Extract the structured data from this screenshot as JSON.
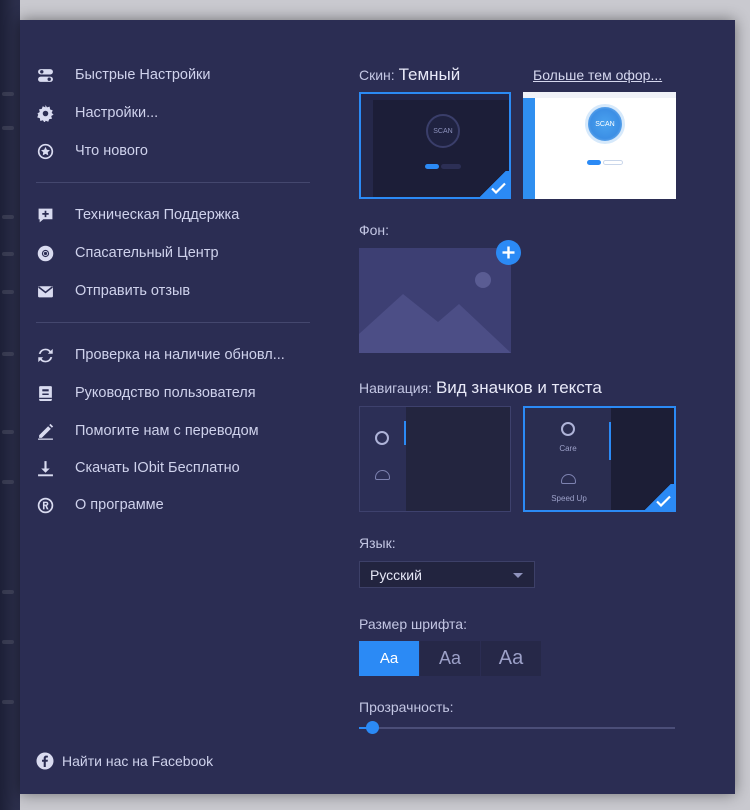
{
  "menu": {
    "items": [
      {
        "label": "Быстрые Настройки",
        "icon": "toggle-icon"
      },
      {
        "label": "Настройки...",
        "icon": "gear-icon"
      },
      {
        "label": "Что нового",
        "icon": "star-icon"
      },
      {
        "label": "Техническая Поддержка",
        "icon": "support-chat-icon"
      },
      {
        "label": "Спасательный Центр",
        "icon": "lifebuoy-icon"
      },
      {
        "label": "Отправить отзыв",
        "icon": "envelope-icon"
      },
      {
        "label": "Проверка на наличие обновл...",
        "icon": "refresh-icon"
      },
      {
        "label": "Руководство пользователя",
        "icon": "manual-icon"
      },
      {
        "label": "Помогите нам с переводом",
        "icon": "pencil-icon"
      },
      {
        "label": "Скачать IObit Бесплатно",
        "icon": "download-icon"
      },
      {
        "label": "О программе",
        "icon": "registered-icon"
      }
    ],
    "facebook_label": "Найти нас на Facebook"
  },
  "skin": {
    "label": "Скин:",
    "value": "Темный",
    "more_link": "Больше тем офор...",
    "scan_text": "SCAN"
  },
  "background": {
    "label": "Фон:"
  },
  "navigation": {
    "label": "Навигация:",
    "value": "Вид значков и текста",
    "care_label": "Care",
    "speedup_label": "Speed Up"
  },
  "language": {
    "label": "Язык:",
    "value": "Русский"
  },
  "font_size": {
    "label": "Размер шрифта:",
    "options": [
      "Aa",
      "Aa",
      "Aa"
    ],
    "selected_index": 0
  },
  "transparency": {
    "label": "Прозрачность:",
    "value": 0.04
  },
  "colors": {
    "panel_bg": "#2b2d53",
    "accent": "#2b8af5",
    "text": "#cfd2ec"
  }
}
